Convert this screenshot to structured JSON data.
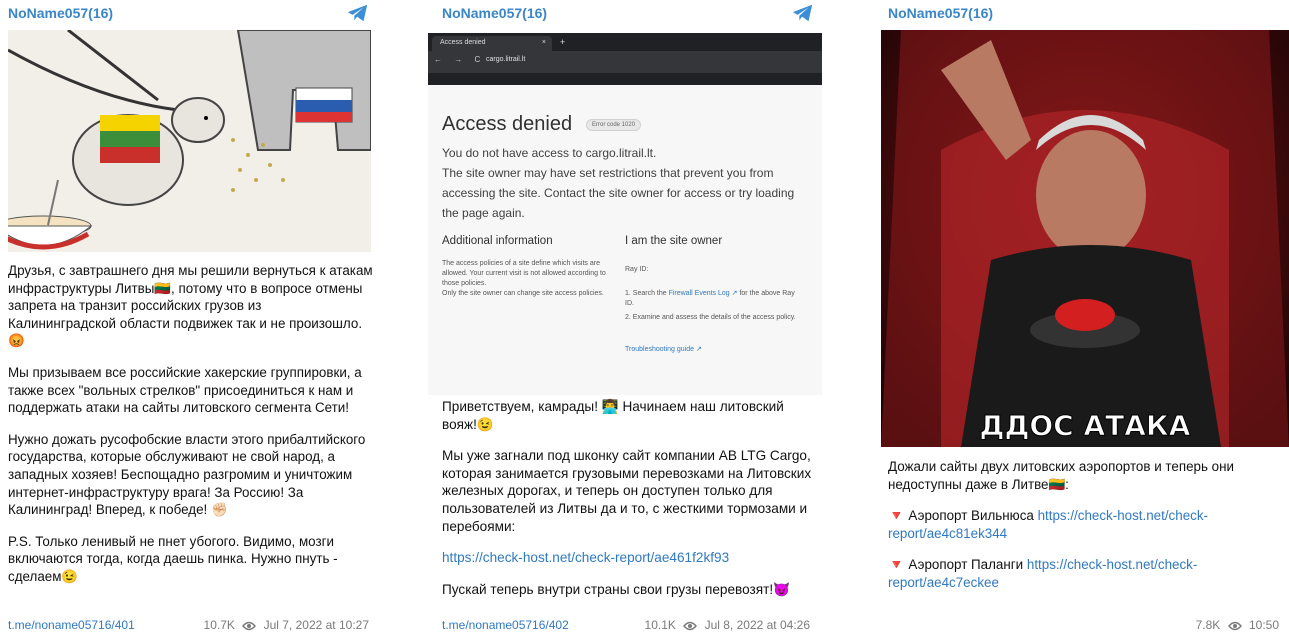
{
  "posts": [
    {
      "channel": "NoName057(16)",
      "paragraphs": [
        "Друзья, с завтрашнего дня мы решили вернуться к атакам инфраструктуры Литвы🇱🇹, потому что в вопросе отмены запрета на транзит российских грузов из Калининградской области подвижек так и не произошло.😡",
        "Мы призываем все российские хакерские группировки, а также всех \"вольных стрелков\" присоединиться к нам и поддержать атаки на сайты литовского сегмента Сети!",
        "Нужно дожать русофобские власти этого прибалтийского государства, которые обслуживают не свой народ, а западных хозяев! Беспощадно разгромим и уничтожим интернет-инфраструктуру врага! За Россию! За Калининград! Вперед, к победе! ✊🏻",
        "P.S. Только ленивый не пнет убогого. Видимо, мозги включаются тогда, когда даешь пинка. Нужно пнуть - сделаем😉"
      ],
      "link": "t.me/noname05716/401",
      "views": "10.7K",
      "date": "Jul 7, 2022 at 10:27"
    },
    {
      "channel": "NoName057(16)",
      "screenshot": {
        "tab_title": "Access denied",
        "tab_close": "×",
        "tab_new": "+",
        "nav": "← → C",
        "url": "cargo.litrail.lt",
        "title": "Access denied",
        "error_code": "Error code 1020",
        "body_lines": [
          "You do not have access to cargo.litrail.lt.",
          "The site owner may have set restrictions that prevent you from accessing the site. Contact the site owner for access or try loading the page again."
        ],
        "additional_title": "Additional information",
        "additional_text": "The access policies of a site define which visits are allowed. Your current visit is not allowed according to those policies.\nOnly the site owner can change site access policies.",
        "owner_title": "I am the site owner",
        "ray_id": "Ray ID:",
        "step1_pre": "1. Search the ",
        "step1_link": "Firewall Events Log ↗",
        "step1_post": " for the above Ray ID.",
        "step2": "2. Examine and assess the details of the access policy.",
        "troubleshoot": "Troubleshooting guide ↗"
      },
      "paragraphs": [
        "Приветствуем, камрады! 👨‍💻 Начинаем наш литовский вояж!😉",
        "Мы уже загнали под шконку сайт компании AB LTG Cargo, которая занимается грузовыми перевозками на Литовских железных дорогах, и теперь он доступен только для пользователей из Литвы да и то, с жесткими тормозами и перебоями:"
      ],
      "report_link": "https://check-host.net/check-report/ae461f2kf93",
      "last_paragraph": "Пускай теперь внутри страны свои грузы перевозят!😈",
      "link": "t.me/noname05716/402",
      "views": "10.1K",
      "date": "Jul 8, 2022 at 04:26"
    },
    {
      "channel": "NoName057(16)",
      "image_caption": "ДДОС АТАКА",
      "intro": "Дожали сайты двух литовских аэропортов и теперь они недоступны даже в Литве🇱🇹:",
      "item1_label": "🔻 Аэропорт Вильнюса ",
      "item1_link": "https://check-host.net/check-report/ae4c81ek344",
      "item2_label": "🔻 Аэропорт Паланги ",
      "item2_link": "https://check-host.net/check-report/ae4c7eckee",
      "views": "7.8K",
      "date": "10:50"
    }
  ],
  "colors": {
    "channel": "#3a86c8",
    "link": "#2f79c2",
    "meta": "#7a7a7a"
  }
}
